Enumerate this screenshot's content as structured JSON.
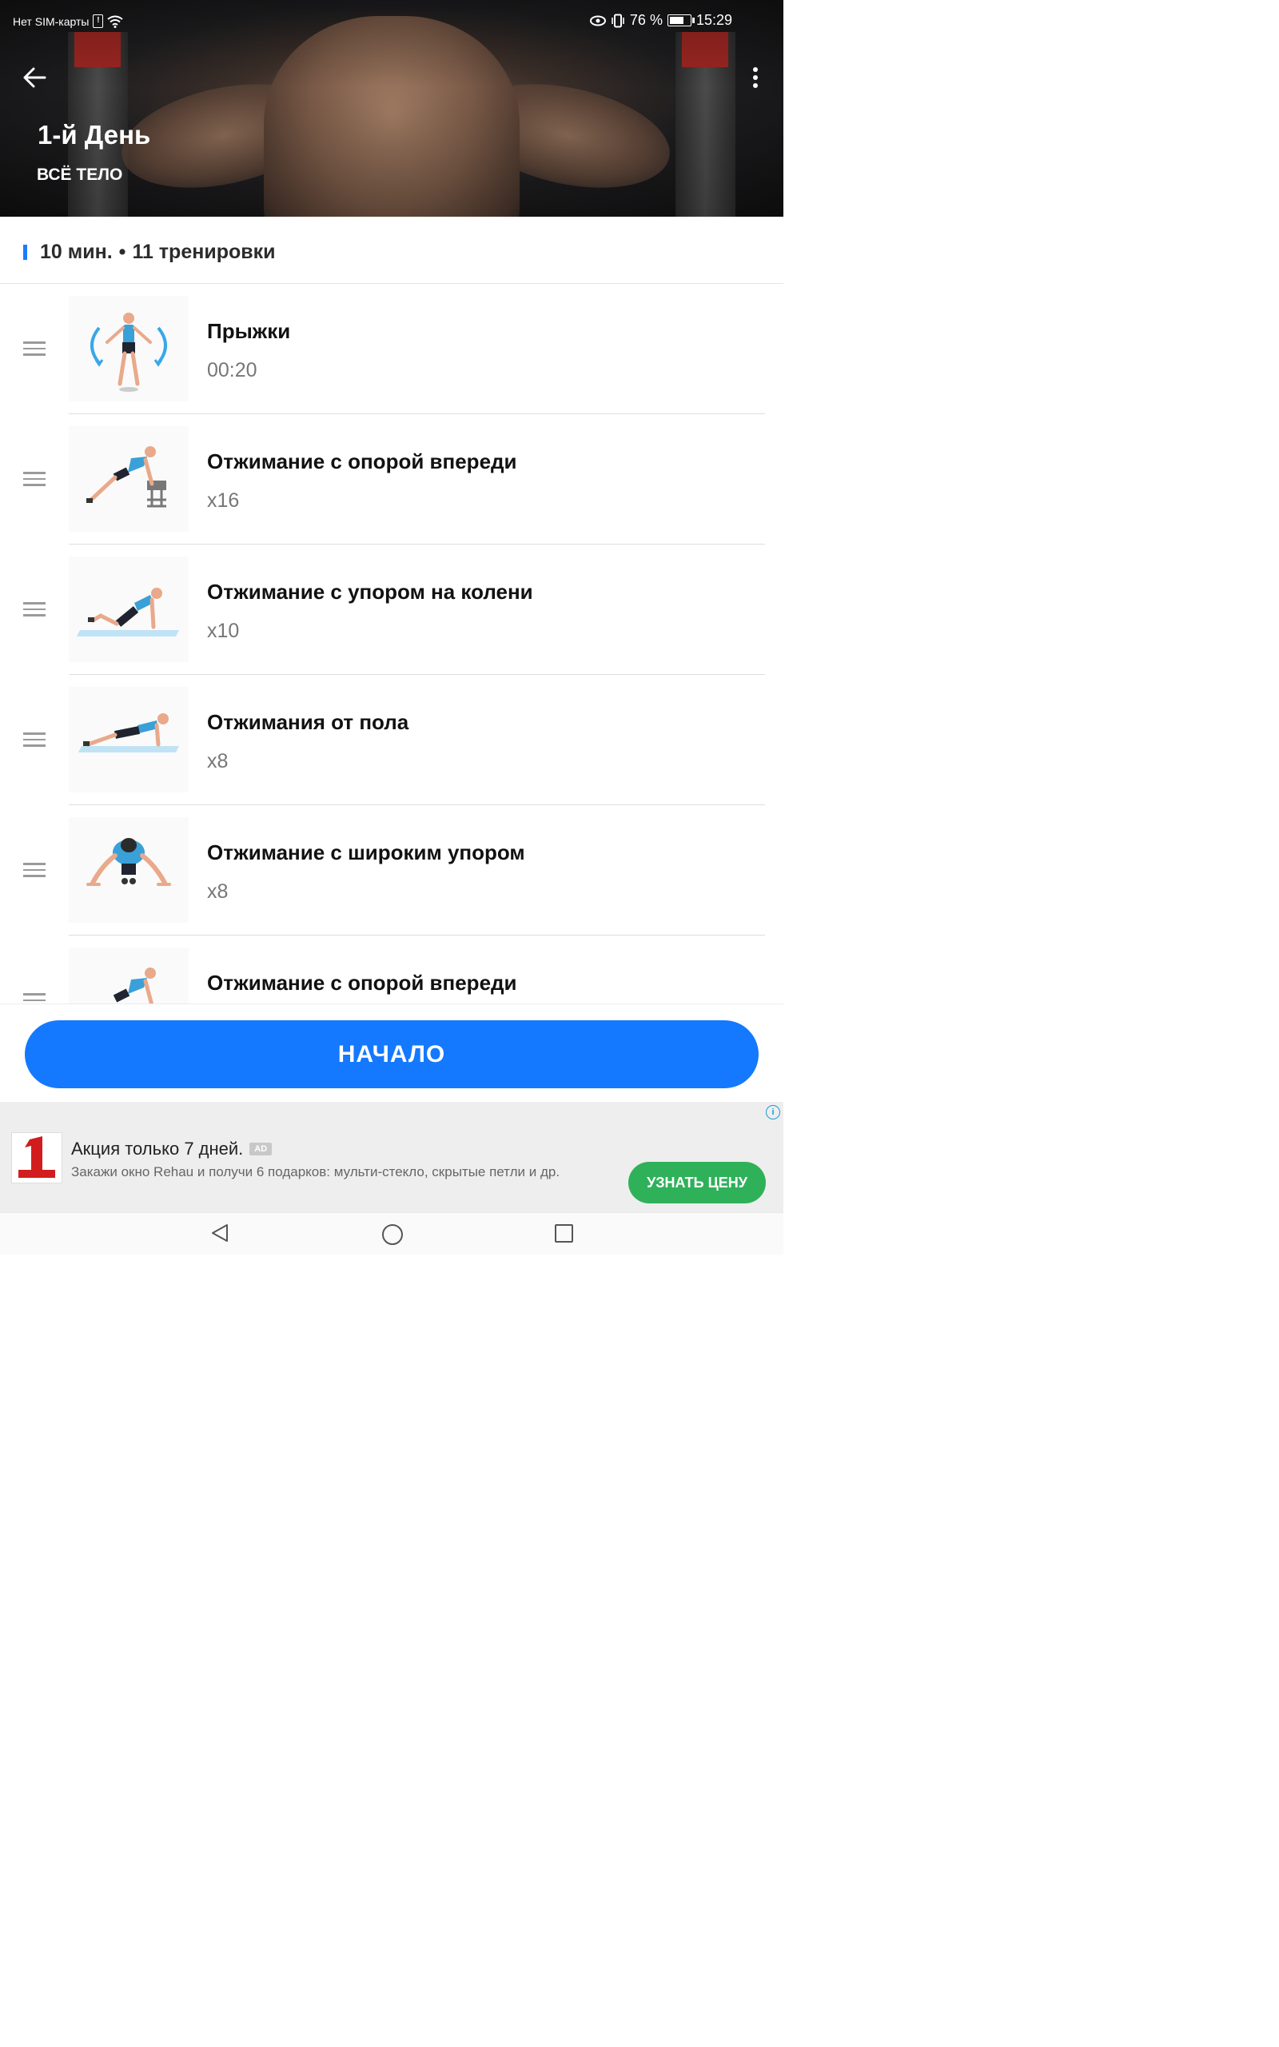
{
  "status_bar": {
    "carrier": "Нет SIM-карты",
    "battery": "76 %",
    "time": "15:29"
  },
  "header": {
    "title": "1-й День",
    "subtitle": "ВСЁ ТЕЛО"
  },
  "summary": {
    "duration": "10 мин.",
    "separator": "•",
    "count": "11 тренировки",
    "accent_color": "#1a7cff"
  },
  "exercises": [
    {
      "name": "Прыжки",
      "value": "00:20",
      "icon": "jumping-jacks-figure"
    },
    {
      "name": "Отжимание с опорой впереди",
      "value": "x16",
      "icon": "incline-pushup-figure"
    },
    {
      "name": "Отжимание с упором на колени",
      "value": "x10",
      "icon": "knee-pushup-figure"
    },
    {
      "name": "Отжимания от пола",
      "value": "x8",
      "icon": "pushup-figure"
    },
    {
      "name": "Отжимание с широким упором",
      "value": "x8",
      "icon": "wide-pushup-figure"
    },
    {
      "name": "Отжимание с опорой впереди",
      "value": "",
      "icon": "incline-pushup-figure"
    }
  ],
  "start_button": {
    "label": "НАЧАЛО",
    "color": "#1479ff"
  },
  "ad": {
    "title": "Акция только 7 дней.",
    "badge": "AD",
    "description": "Закажи окно Rehau и получи 6 подарков: мульти-стекло, скрытые петли и др.",
    "cta": "УЗНАТЬ ЦЕНУ",
    "cta_color": "#2fb15a"
  },
  "nav": {
    "icons": [
      "back-triangle-icon",
      "home-circle-icon",
      "recents-square-icon"
    ]
  }
}
